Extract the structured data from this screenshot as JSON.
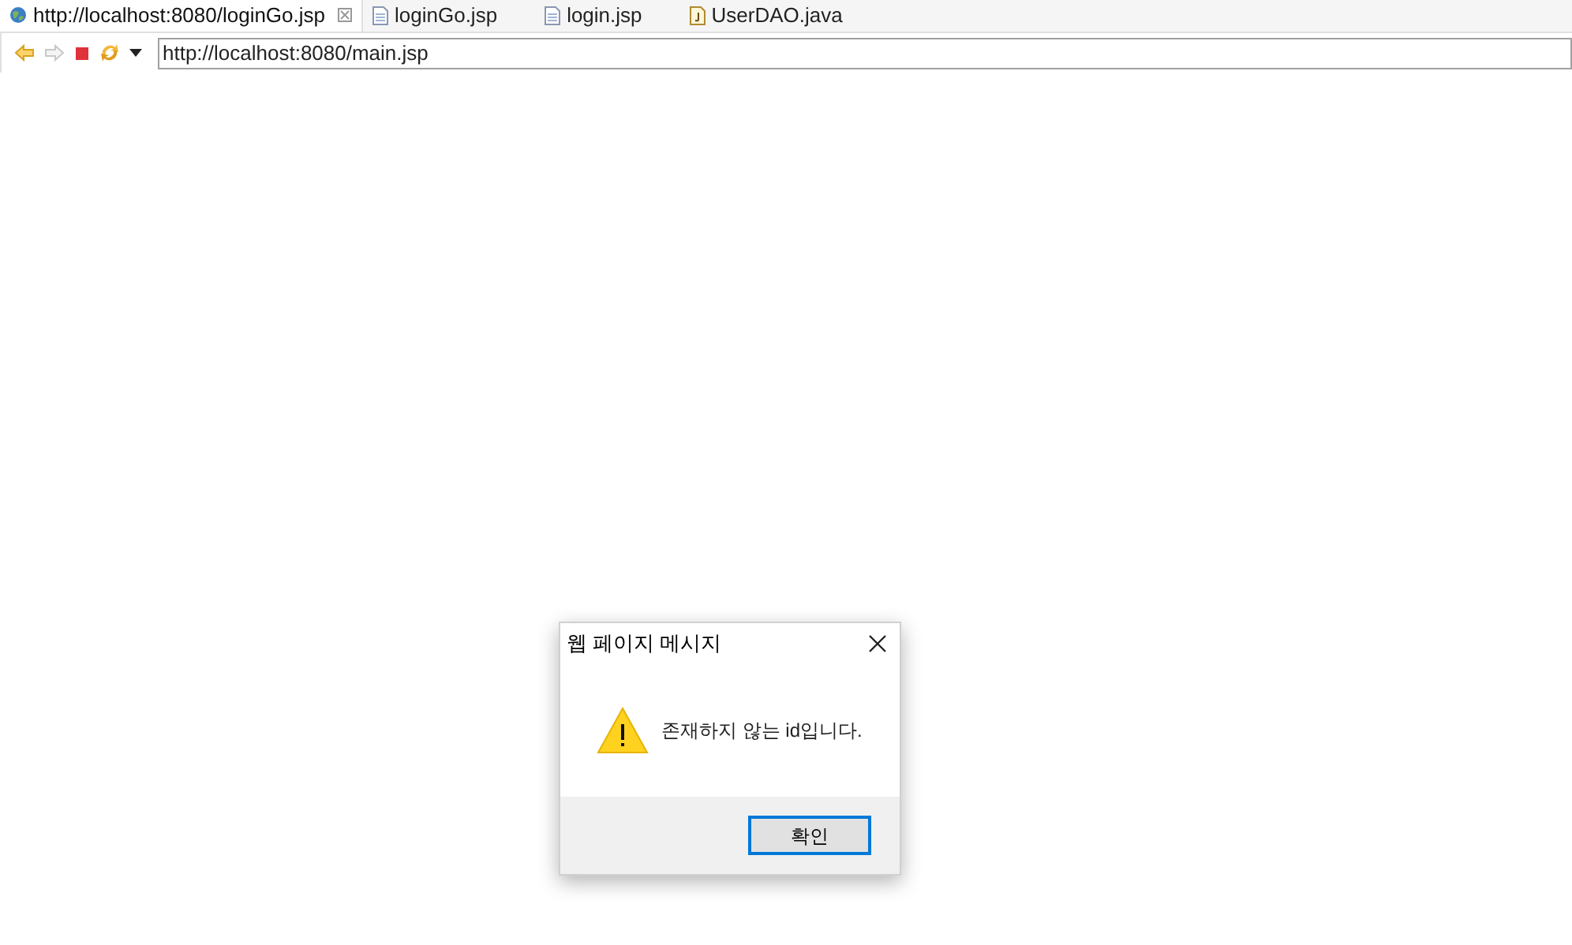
{
  "tabs": [
    {
      "label": "http://localhost:8080/loginGo.jsp",
      "kind": "browser",
      "selected": true
    },
    {
      "label": "loginGo.jsp",
      "kind": "jsp",
      "selected": false
    },
    {
      "label": "login.jsp",
      "kind": "jsp",
      "selected": false
    },
    {
      "label": "UserDAO.java",
      "kind": "java",
      "selected": false
    }
  ],
  "address": {
    "value": "http://localhost:8080/main.jsp"
  },
  "dialog": {
    "title": "웹 페이지 메시지",
    "message": "존재하지 않는 id입니다.",
    "buttons": [
      "확인"
    ]
  }
}
